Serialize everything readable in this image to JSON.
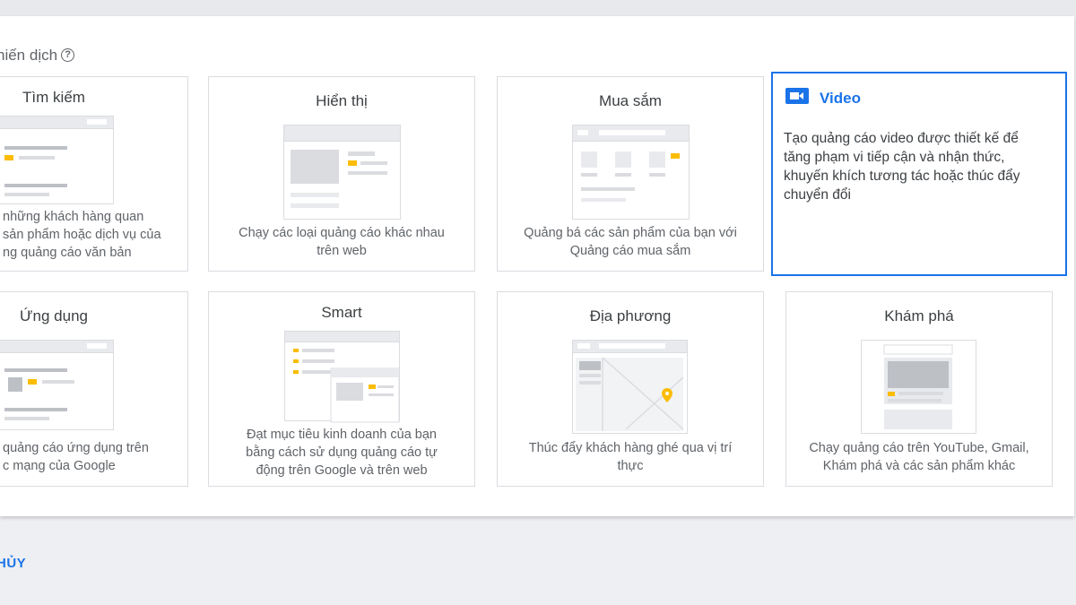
{
  "section": {
    "title": "hiến dịch",
    "help_icon": "help-icon"
  },
  "cards": {
    "search": {
      "title": "Tìm kiếm",
      "desc": [
        "những khách hàng quan",
        "sản phẩm hoặc dịch vụ của",
        "ng quảng cáo văn bản"
      ]
    },
    "display": {
      "title": "Hiển thị",
      "desc": [
        "Chạy các loại quảng cáo khác nhau",
        "trên web"
      ]
    },
    "shopping": {
      "title": "Mua sắm",
      "desc": [
        "Quảng bá các sản phẩm của bạn với",
        "Quảng cáo mua sắm"
      ]
    },
    "video": {
      "title": "Video",
      "icon": "video-camera-icon",
      "desc": [
        "Tạo quảng cáo video được thiết kế để",
        "tăng phạm vi tiếp cận và nhận thức,",
        "khuyến khích tương tác hoặc thúc đẩy",
        "chuyển đổi"
      ]
    },
    "app": {
      "title": "Ứng dụng",
      "desc": [
        "quảng cáo ứng dụng trên",
        "c mạng của Google"
      ]
    },
    "smart": {
      "title": "Smart",
      "desc": [
        "Đạt mục tiêu kinh doanh của bạn",
        "bằng cách sử dụng quảng cáo tự",
        "động trên Google và trên web"
      ]
    },
    "local": {
      "title": "Địa phương",
      "desc": [
        "Thúc đẩy khách hàng ghé qua vị trí",
        "thực"
      ]
    },
    "discovery": {
      "title": "Khám phá",
      "desc": [
        "Chạy quảng cáo trên YouTube, Gmail,",
        "Khám phá và các sản phẩm khác"
      ]
    }
  },
  "footer": {
    "cancel_label": "HỦY"
  },
  "colors": {
    "accent": "#1a73e8",
    "highlight": "#fbbc04",
    "border": "#dadce0"
  }
}
